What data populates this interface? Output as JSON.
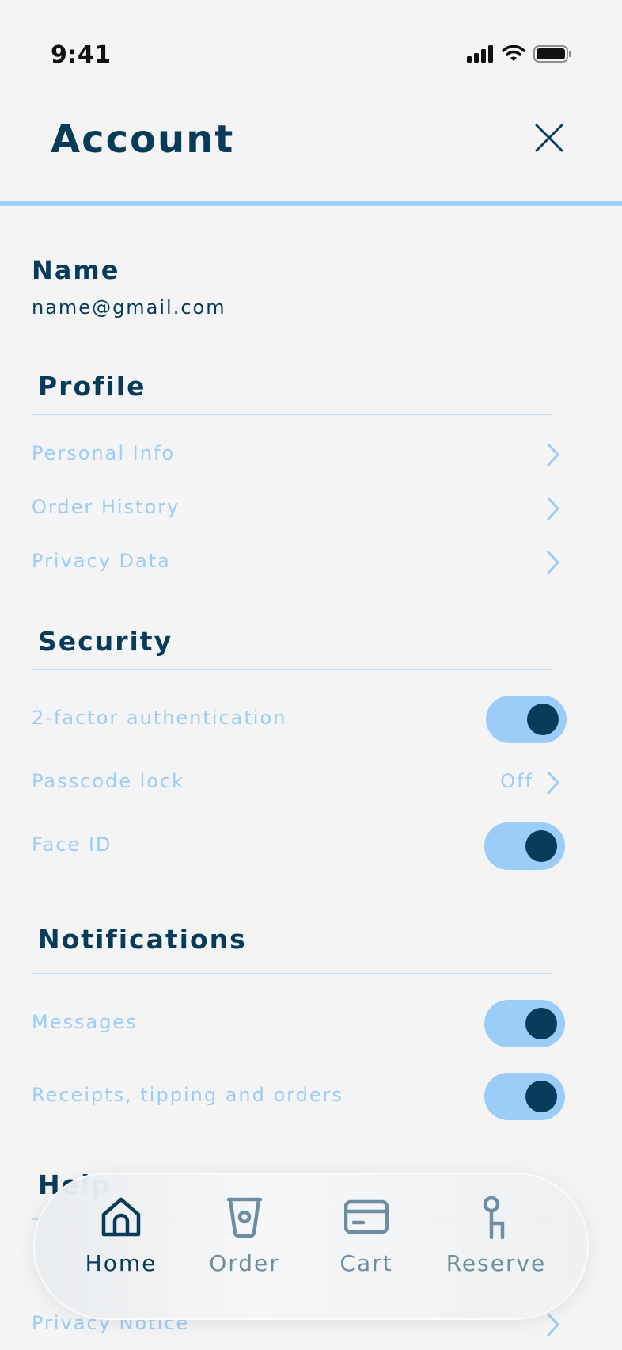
{
  "status_bar": {
    "time": "9:41"
  },
  "header": {
    "title": "Account"
  },
  "user": {
    "name": "Name",
    "email": "name@gmail.com"
  },
  "sections": {
    "profile": {
      "title": "Profile",
      "items": [
        {
          "label": "Personal Info"
        },
        {
          "label": "Order History"
        },
        {
          "label": "Privacy Data"
        }
      ]
    },
    "security": {
      "title": "Security",
      "items": [
        {
          "label": "2-factor authentication",
          "toggle_on": true
        },
        {
          "label": "Passcode lock",
          "value": "Off"
        },
        {
          "label": "Face ID",
          "toggle_on": true
        }
      ]
    },
    "notifications": {
      "title": "Notifications",
      "items": [
        {
          "label": "Messages",
          "toggle_on": true
        },
        {
          "label": "Receipts, tipping and orders",
          "toggle_on": true
        }
      ]
    },
    "help": {
      "title": "Help",
      "items": [
        {
          "label": "Privacy Notice"
        }
      ]
    }
  },
  "bottom_nav": {
    "items": [
      {
        "label": "Home",
        "icon": "home-icon",
        "active": true
      },
      {
        "label": "Order",
        "icon": "cup-icon",
        "active": false
      },
      {
        "label": "Cart",
        "icon": "card-icon",
        "active": false
      },
      {
        "label": "Reserve",
        "icon": "chair-icon",
        "active": false
      }
    ]
  },
  "colors": {
    "primary": "#073b5a",
    "accent": "#9ccdf8",
    "background": "#f4f4f5",
    "nav_inactive": "#6d8ea3"
  }
}
